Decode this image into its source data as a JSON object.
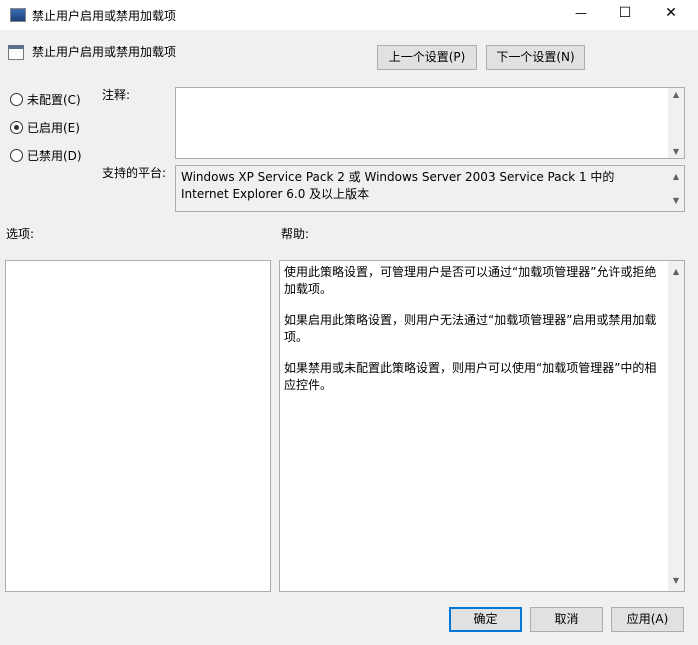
{
  "window": {
    "title": "禁止用户启用或禁用加载项",
    "minimize": "—",
    "maximize": "☐",
    "close": "✕"
  },
  "header": {
    "policy_name": "禁止用户启用或禁用加载项",
    "prev_button": "上一个设置(P)",
    "next_button": "下一个设置(N)"
  },
  "state": {
    "options": [
      {
        "label": "未配置(C)",
        "checked": false
      },
      {
        "label": "已启用(E)",
        "checked": true
      },
      {
        "label": "已禁用(D)",
        "checked": false
      }
    ]
  },
  "comment": {
    "label": "注释:",
    "value": ""
  },
  "platform": {
    "label": "支持的平台:",
    "value": "Windows XP Service Pack 2 或 Windows Server 2003 Service Pack 1 中的 Internet Explorer 6.0 及以上版本"
  },
  "options_label": "选项:",
  "help": {
    "label": "帮助:",
    "paragraphs": [
      "使用此策略设置，可管理用户是否可以通过“加载项管理器”允许或拒绝加载项。",
      "如果启用此策略设置，则用户无法通过“加载项管理器”启用或禁用加载项。",
      "如果禁用或未配置此策略设置，则用户可以使用“加载项管理器”中的相应控件。"
    ]
  },
  "footer": {
    "ok": "确定",
    "cancel": "取消",
    "apply": "应用(A)"
  }
}
